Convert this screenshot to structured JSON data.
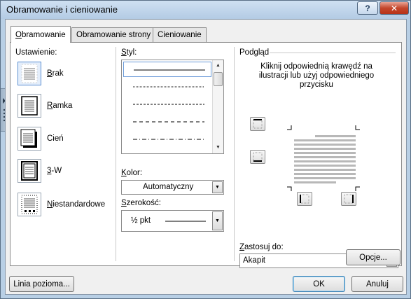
{
  "window": {
    "title": "Obramowanie i cieniowanie",
    "help_label": "?",
    "close_label": "✕"
  },
  "tabs": [
    {
      "label": "Obramowanie"
    },
    {
      "label": "Obramowanie strony"
    },
    {
      "label": "Cieniowanie"
    }
  ],
  "setting": {
    "heading": "Ustawienie:",
    "options": [
      {
        "label": "Brak"
      },
      {
        "label": "Ramka"
      },
      {
        "label": "Cień"
      },
      {
        "label": "3-W"
      },
      {
        "label": "Niestandardowe"
      }
    ]
  },
  "style": {
    "heading": "Styl:"
  },
  "color": {
    "label": "Kolor:",
    "value": "Automatyczny"
  },
  "width": {
    "label": "Szerokość:",
    "value": "½ pkt"
  },
  "preview": {
    "heading": "Podgląd",
    "instruction": "Kliknij odpowiednią krawędź na ilustracji lub użyj odpowiedniego przycisku"
  },
  "apply_to": {
    "label": "Zastosuj do:",
    "value": "Akapit"
  },
  "buttons": {
    "options": "Opcje...",
    "horizontal_line": "Linia pozioma...",
    "ok": "OK",
    "cancel": "Anuluj"
  }
}
